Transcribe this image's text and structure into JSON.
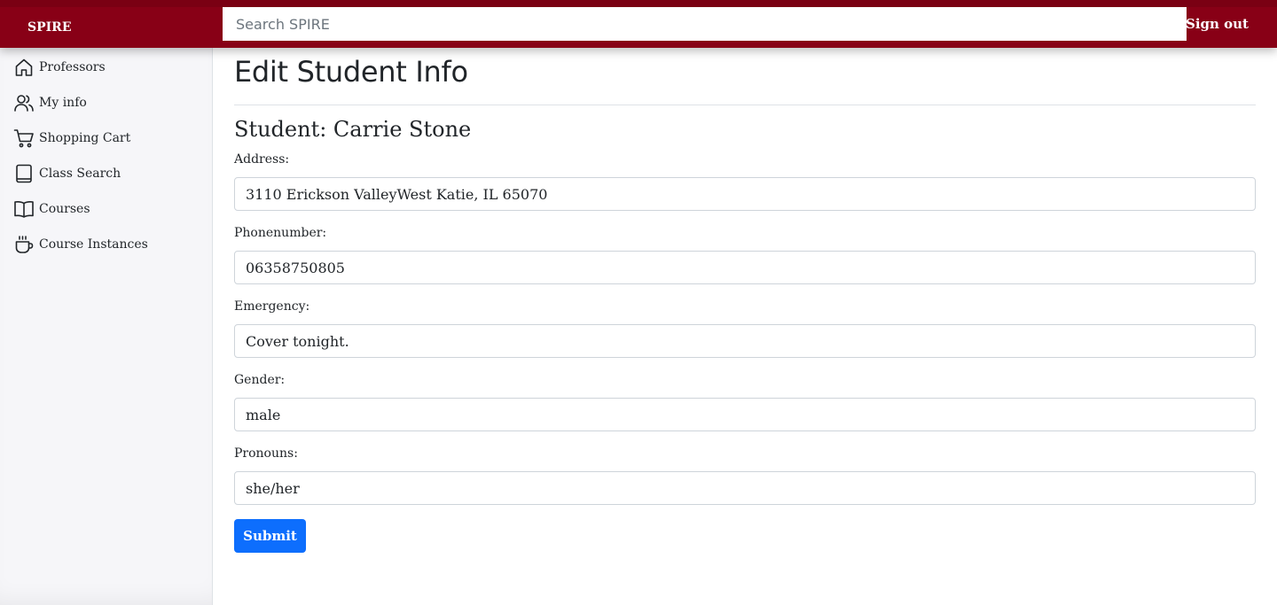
{
  "header": {
    "brand": "SPIRE",
    "search_placeholder": "Search SPIRE",
    "signout_label": "Sign out"
  },
  "sidebar": {
    "items": [
      {
        "label": "Professors",
        "icon": "house-icon"
      },
      {
        "label": "My info",
        "icon": "people-icon"
      },
      {
        "label": "Shopping Cart",
        "icon": "cart-icon"
      },
      {
        "label": "Class Search",
        "icon": "book-icon"
      },
      {
        "label": "Courses",
        "icon": "open-book-icon"
      },
      {
        "label": "Course Instances",
        "icon": "cup-icon"
      }
    ]
  },
  "main": {
    "title": "Edit Student Info",
    "student_heading": "Student: Carrie Stone",
    "fields": [
      {
        "label": "Address:",
        "value": "3110 Erickson ValleyWest Katie, IL 65070"
      },
      {
        "label": "Phonenumber:",
        "value": "06358750805"
      },
      {
        "label": "Emergency:",
        "value": "Cover tonight."
      },
      {
        "label": "Gender:",
        "value": "male"
      },
      {
        "label": "Pronouns:",
        "value": "she/her"
      }
    ],
    "submit_label": "Submit"
  },
  "colors": {
    "header_bg": "#880016",
    "sidebar_bg": "#f6f6f9",
    "submit_bg": "#0d6efd"
  }
}
